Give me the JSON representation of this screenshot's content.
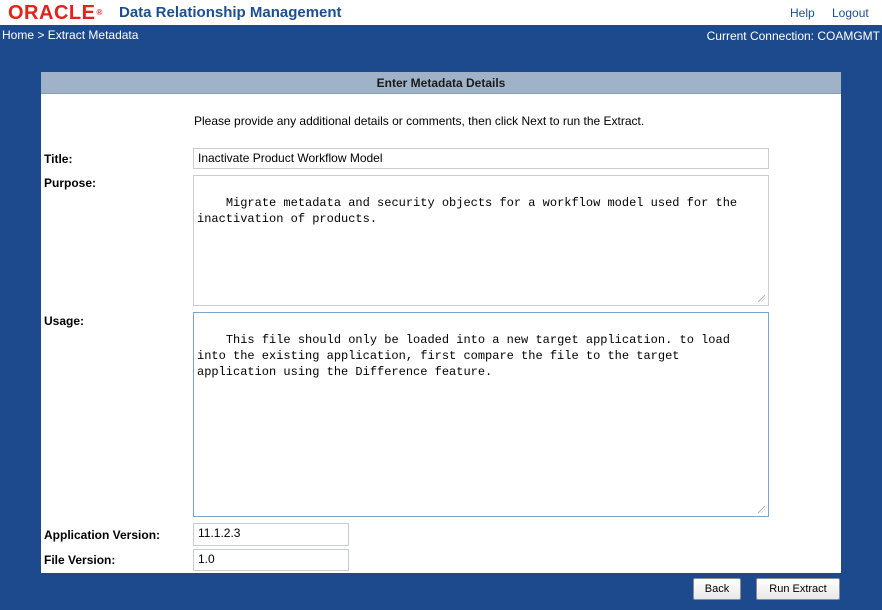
{
  "header": {
    "logo_text": "ORACLE",
    "logo_mark": "®",
    "app_title": "Data Relationship Management",
    "links": {
      "help": "Help",
      "logout": "Logout"
    }
  },
  "breadcrumb": {
    "home": "Home",
    "separator": ">",
    "current": "Extract Metadata",
    "connection": "Current Connection: COAMGMT"
  },
  "panel": {
    "title": "Enter Metadata Details",
    "instructions": "Please provide any additional details or comments, then click Next to run the Extract.",
    "fields": {
      "title": {
        "label": "Title:",
        "value": "Inactivate Product Workflow Model"
      },
      "purpose": {
        "label": "Purpose:",
        "value": "Migrate metadata and security objects for a workflow model used for the inactivation of products."
      },
      "usage": {
        "label": "Usage:",
        "value": "This file should only be loaded into a new target application. to load into the existing application, first compare the file to the target application using the Difference feature."
      },
      "app_version": {
        "label": "Application Version:",
        "value": "11.1.2.3"
      },
      "file_version": {
        "label": "File Version:",
        "value": "1.0"
      }
    }
  },
  "buttons": {
    "back": "Back",
    "run_extract": "Run Extract"
  },
  "colors": {
    "background": "#1d4a8c",
    "oracle_red": "#e2231a",
    "brand_blue": "#1c4e94",
    "panel_header": "#9fb2c8"
  }
}
